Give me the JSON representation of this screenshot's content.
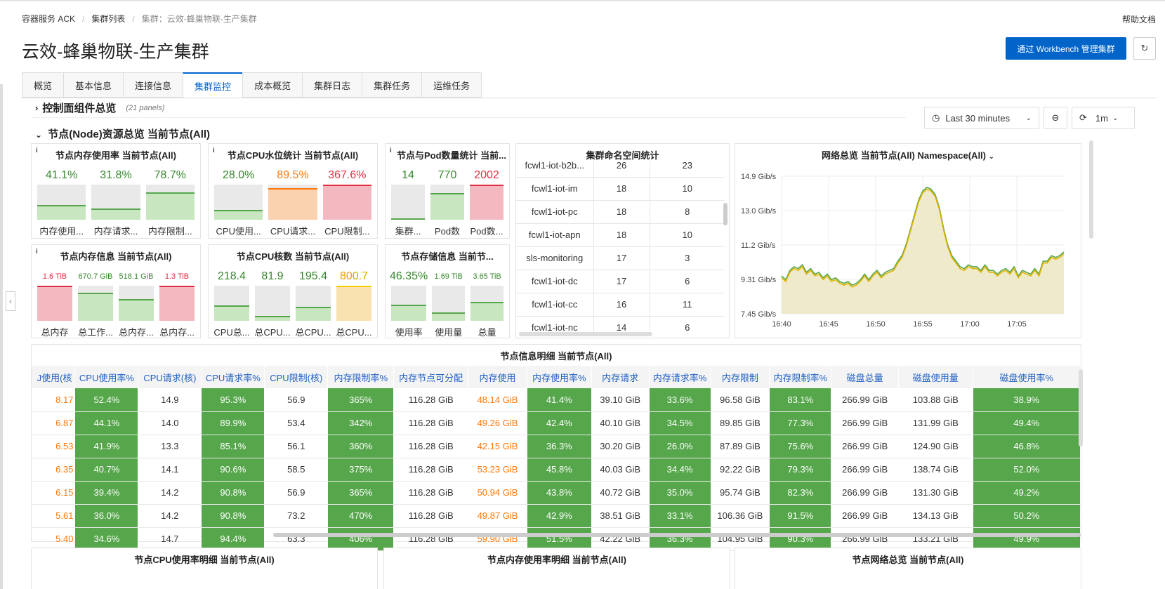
{
  "breadcrumb": {
    "items": [
      "容器服务 ACK",
      "集群列表",
      "集群：云效-蜂巢物联-生产集群"
    ],
    "sep": "/"
  },
  "help_label": "帮助文档",
  "page_title": "云效-蜂巢物联-生产集群",
  "workbench_label": "通过 Workbench 管理集群",
  "tabs": [
    "概览",
    "基本信息",
    "连接信息",
    "集群监控",
    "成本概览",
    "集群日志",
    "集群任务",
    "运维任务"
  ],
  "active_tab": "集群监控",
  "collapsed_row": {
    "title": "控制面组件总览",
    "sub": "(21 panels)"
  },
  "open_row": {
    "title": "节点(Node)资源总览 当前节点(All)"
  },
  "time": {
    "range": "Last 30 minutes",
    "refresh": "1m"
  },
  "colors": {
    "green": "#56a64b",
    "orange": "#ff780a",
    "red": "#e02f44",
    "blue": "#0064c8",
    "link": "#1f60c4"
  },
  "panels": {
    "mem_usage": {
      "title": "节点内存使用率 当前节点(All)",
      "gauges": [
        {
          "value": "41.1%",
          "label": "内存使用...",
          "level": 0.411,
          "color": "green"
        },
        {
          "value": "31.8%",
          "label": "内存请求...",
          "level": 0.318,
          "color": "green"
        },
        {
          "value": "78.7%",
          "label": "内存限制...",
          "level": 0.787,
          "color": "green"
        }
      ]
    },
    "cpu_water": {
      "title": "节点CPU水位统计 当前节点(All)",
      "gauges": [
        {
          "value": "28.0%",
          "label": "CPU使用...",
          "level": 0.28,
          "color": "green"
        },
        {
          "value": "89.5%",
          "label": "CPU请求...",
          "level": 0.895,
          "color": "orange"
        },
        {
          "value": "367.6%",
          "label": "CPU限制...",
          "level": 1.0,
          "color": "red"
        }
      ]
    },
    "pod_count": {
      "title": "节点与Pod数量统计 当前...",
      "gauges": [
        {
          "value": "14",
          "label": "集群...",
          "level": 0.05,
          "color": "green"
        },
        {
          "value": "770",
          "label": "Pod数",
          "level": 0.77,
          "color": "green"
        },
        {
          "value": "2002",
          "label": "Pod数...",
          "level": 1.0,
          "color": "red"
        }
      ]
    },
    "mem_info": {
      "title": "节点内存信息 当前节点(All)",
      "gauges": [
        {
          "value": "1.6 TiB",
          "label": "总内存",
          "level": 1.0,
          "color": "red"
        },
        {
          "value": "670.7 GiB",
          "label": "总工作...",
          "level": 0.8,
          "color": "green"
        },
        {
          "value": "518.1 GiB",
          "label": "总内存...",
          "level": 0.62,
          "color": "green"
        },
        {
          "value": "1.3 TiB",
          "label": "总内存...",
          "level": 1.0,
          "color": "red"
        }
      ]
    },
    "cpu_cores": {
      "title": "节点CPU核数 当前节点(All)",
      "gauges": [
        {
          "value": "218.4",
          "label": "CPU总...",
          "level": 0.45,
          "color": "green"
        },
        {
          "value": "81.9",
          "label": "总CPU...",
          "level": 0.15,
          "color": "green"
        },
        {
          "value": "195.4",
          "label": "总CPU...",
          "level": 0.4,
          "color": "green"
        },
        {
          "value": "800.7",
          "label": "总CPU...",
          "level": 1.0,
          "color": "yellow"
        }
      ]
    },
    "storage": {
      "title": "节点存储信息 当前节...",
      "gauges": [
        {
          "value": "46.35%",
          "label": "使用率",
          "level": 0.46,
          "color": "green"
        },
        {
          "value": "1.69 TiB",
          "label": "使用量",
          "level": 0.25,
          "color": "green"
        },
        {
          "value": "3.65 TiB",
          "label": "总量",
          "level": 0.55,
          "color": "green"
        }
      ]
    }
  },
  "namespaces": {
    "title": "集群命名空间统计",
    "rows": [
      [
        "fcwl1-iot-b2b...",
        "26",
        "23"
      ],
      [
        "fcwl1-iot-im",
        "18",
        "10"
      ],
      [
        "fcwl1-iot-pc",
        "18",
        "8"
      ],
      [
        "fcwl1-iot-apn",
        "18",
        "10"
      ],
      [
        "sls-monitoring",
        "17",
        "3"
      ],
      [
        "fcwl1-iot-dc",
        "17",
        "6"
      ],
      [
        "fcwl1-iot-cc",
        "16",
        "11"
      ],
      [
        "fcwl1-iot-nc",
        "14",
        "6"
      ]
    ]
  },
  "chart_data": {
    "type": "area",
    "title": "网络总览 当前节点(All) Namespace(All)",
    "y_ticks": [
      "14.9 Gib/s",
      "13.0 Gib/s",
      "11.2 Gib/s",
      "9.31 Gib/s",
      "7.45 Gib/s"
    ],
    "x_ticks": [
      "16:40",
      "16:45",
      "16:50",
      "16:55",
      "17:00",
      "17:05"
    ],
    "ylim": [
      7.45,
      14.9
    ],
    "xlim": [
      0,
      30
    ],
    "colors": {
      "a": "#56a64b",
      "b": "#e0b400",
      "fill": "#efeacc"
    },
    "series": [
      {
        "values": [
          9.5,
          9.3,
          9.8,
          10.0,
          9.9,
          10.1,
          9.7,
          9.9,
          9.6,
          9.7,
          9.4,
          9.6,
          9.3,
          9.4,
          9.2,
          9.1,
          9.2,
          9.0,
          9.1,
          9.3,
          9.6,
          9.3,
          9.6,
          9.8,
          9.5,
          9.7,
          9.8,
          9.9,
          10.3,
          10.6,
          11.2,
          12.0,
          12.8,
          13.6,
          14.1,
          14.3,
          14.2,
          13.9,
          13.2,
          12.1,
          11.2,
          10.6,
          10.3,
          10.0,
          9.9,
          10.1,
          10.0,
          10.0,
          9.8,
          10.1,
          9.8,
          9.8,
          9.6,
          9.8,
          9.9,
          9.7,
          10.0,
          9.5,
          9.8,
          9.7,
          9.6,
          9.9,
          9.6,
          10.3,
          10.3,
          10.6,
          10.5,
          10.6,
          10.8
        ]
      },
      {
        "values": [
          9.4,
          9.2,
          9.7,
          9.9,
          9.8,
          10.0,
          9.6,
          9.8,
          9.5,
          9.6,
          9.3,
          9.5,
          9.2,
          9.3,
          9.1,
          9.0,
          9.1,
          8.9,
          9.0,
          9.2,
          9.5,
          9.2,
          9.5,
          9.7,
          9.4,
          9.6,
          9.7,
          9.8,
          10.2,
          10.5,
          11.1,
          11.9,
          12.7,
          13.5,
          14.0,
          14.2,
          14.1,
          13.8,
          13.1,
          12.0,
          11.1,
          10.5,
          10.2,
          9.9,
          9.8,
          10.0,
          9.9,
          9.9,
          9.7,
          10.0,
          9.7,
          9.7,
          9.5,
          9.7,
          9.8,
          9.6,
          9.9,
          9.4,
          9.7,
          9.6,
          9.5,
          9.8,
          9.5,
          10.2,
          10.2,
          10.5,
          10.4,
          10.5,
          10.7
        ]
      }
    ]
  },
  "node_table": {
    "title": "节点信息明细 当前节点(All)",
    "columns": [
      "J使用(核",
      "CPU使用率%",
      "CPU请求(核)",
      "CPU请求率%",
      "CPU限制(核)",
      "内存限制率%",
      "内存节点可分配",
      "内存使用",
      "内存使用率%",
      "内存请求",
      "内存请求率%",
      "内存限制",
      "内存限制率%",
      "磁盘总量",
      "磁盘使用量",
      "磁盘使用率%"
    ],
    "rows": [
      [
        "8.17",
        "52.4%",
        "14.9",
        "95.3%",
        "56.9",
        "365%",
        "116.28 GiB",
        "48.14 GiB",
        "41.4%",
        "39.10 GiB",
        "33.6%",
        "96.58 GiB",
        "83.1%",
        "266.99 GiB",
        "103.88 GiB",
        "38.9%"
      ],
      [
        "6.87",
        "44.1%",
        "14.0",
        "89.9%",
        "53.4",
        "342%",
        "116.28 GiB",
        "49.26 GiB",
        "42.4%",
        "40.10 GiB",
        "34.5%",
        "89.85 GiB",
        "77.3%",
        "266.99 GiB",
        "131.99 GiB",
        "49.4%"
      ],
      [
        "6.53",
        "41.9%",
        "13.3",
        "85.1%",
        "56.1",
        "360%",
        "116.28 GiB",
        "42.15 GiB",
        "36.3%",
        "30.20 GiB",
        "26.0%",
        "87.89 GiB",
        "75.6%",
        "266.99 GiB",
        "124.90 GiB",
        "46.8%"
      ],
      [
        "6.35",
        "40.7%",
        "14.1",
        "90.6%",
        "58.5",
        "375%",
        "116.28 GiB",
        "53.23 GiB",
        "45.8%",
        "40.03 GiB",
        "34.4%",
        "92.22 GiB",
        "79.3%",
        "266.99 GiB",
        "138.74 GiB",
        "52.0%"
      ],
      [
        "6.15",
        "39.4%",
        "14.2",
        "90.8%",
        "56.9",
        "365%",
        "116.28 GiB",
        "50.94 GiB",
        "43.8%",
        "40.72 GiB",
        "35.0%",
        "95.74 GiB",
        "82.3%",
        "266.99 GiB",
        "131.30 GiB",
        "49.2%"
      ],
      [
        "5.61",
        "36.0%",
        "14.2",
        "90.8%",
        "73.2",
        "470%",
        "116.28 GiB",
        "49.87 GiB",
        "42.9%",
        "38.51 GiB",
        "33.1%",
        "106.36 GiB",
        "91.5%",
        "266.99 GiB",
        "134.13 GiB",
        "50.2%"
      ],
      [
        "5.40",
        "34.6%",
        "14.7",
        "94.4%",
        "63.3",
        "406%",
        "116.28 GiB",
        "59.90 GiB",
        "51.5%",
        "42.22 GiB",
        "36.3%",
        "104.95 GiB",
        "90.3%",
        "266.99 GiB",
        "133.21 GiB",
        "49.9%"
      ]
    ]
  },
  "bottom_titles": [
    "节点CPU使用率明细 当前节点(All)",
    "节点内存使用率明细 当前节点(All)",
    "节点网络总览 当前节点(All)"
  ]
}
